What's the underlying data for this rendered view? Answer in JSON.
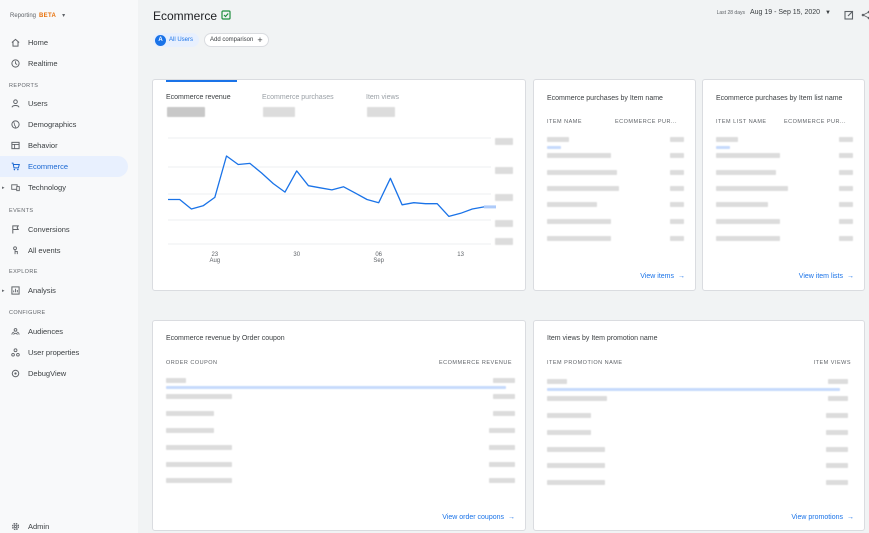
{
  "colors": {
    "accent": "#1a73e8",
    "beta": "#e8710a",
    "active_bg": "#e8f0fe"
  },
  "brand": {
    "product": "Reporting",
    "badge": "BETA"
  },
  "nav": {
    "home": "Home",
    "realtime": "Realtime",
    "reports_section": "REPORTS",
    "users": "Users",
    "demographics": "Demographics",
    "behavior": "Behavior",
    "ecommerce": "Ecommerce",
    "technology": "Technology",
    "events_section": "EVENTS",
    "conversions": "Conversions",
    "all_events": "All events",
    "explore_section": "EXPLORE",
    "analysis": "Analysis",
    "configure_section": "CONFIGURE",
    "audiences": "Audiences",
    "user_properties": "User properties",
    "debugview": "DebugView",
    "admin": "Admin"
  },
  "header": {
    "title": "Ecommerce",
    "segment_avatar": "A",
    "segment": "All Users",
    "add_comparison": "Add comparison",
    "date_prefix": "Last 28 days",
    "date_range": "Aug 19 - Sep 15, 2020"
  },
  "main_card": {
    "tabs": [
      "Ecommerce revenue",
      "Ecommerce purchases",
      "Item views"
    ],
    "x_labels": [
      {
        "day": "23",
        "month": "Aug"
      },
      {
        "day": "30",
        "month": ""
      },
      {
        "day": "06",
        "month": "Sep"
      },
      {
        "day": "13",
        "month": ""
      }
    ]
  },
  "chart_data": {
    "type": "line",
    "title": "",
    "series": [
      {
        "values": [
          0.42,
          0.42,
          0.33,
          0.36,
          0.44,
          0.83,
          0.75,
          0.76,
          0.67,
          0.57,
          0.49,
          0.69,
          0.55,
          0.53,
          0.51,
          0.54,
          0.48,
          0.42,
          0.39,
          0.62,
          0.37,
          0.39,
          0.38,
          0.38,
          0.26,
          0.29,
          0.33,
          0.35
        ]
      }
    ],
    "note_values": "relative values 0-1; y-axis tick labels obscured in source",
    "x_ticks": [
      "23 Aug",
      "30",
      "06 Sep",
      "13"
    ],
    "grid": true
  },
  "purchases_by_item": {
    "title": "Ecommerce purchases by Item name",
    "col1": "ITEM NAME",
    "col2": "ECOMMERCE PUR...",
    "link": "View items"
  },
  "purchases_by_list": {
    "title": "Ecommerce purchases by Item list name",
    "col1": "ITEM LIST NAME",
    "col2": "ECOMMERCE PUR...",
    "link": "View item lists"
  },
  "revenue_by_coupon": {
    "title": "Ecommerce revenue by Order coupon",
    "col1": "ORDER COUPON",
    "col2": "ECOMMERCE REVENUE",
    "link": "View order coupons"
  },
  "views_by_promotion": {
    "title": "Item views by Item promotion name",
    "col1": "ITEM PROMOTION NAME",
    "col2": "ITEM VIEWS",
    "link": "View promotions"
  }
}
